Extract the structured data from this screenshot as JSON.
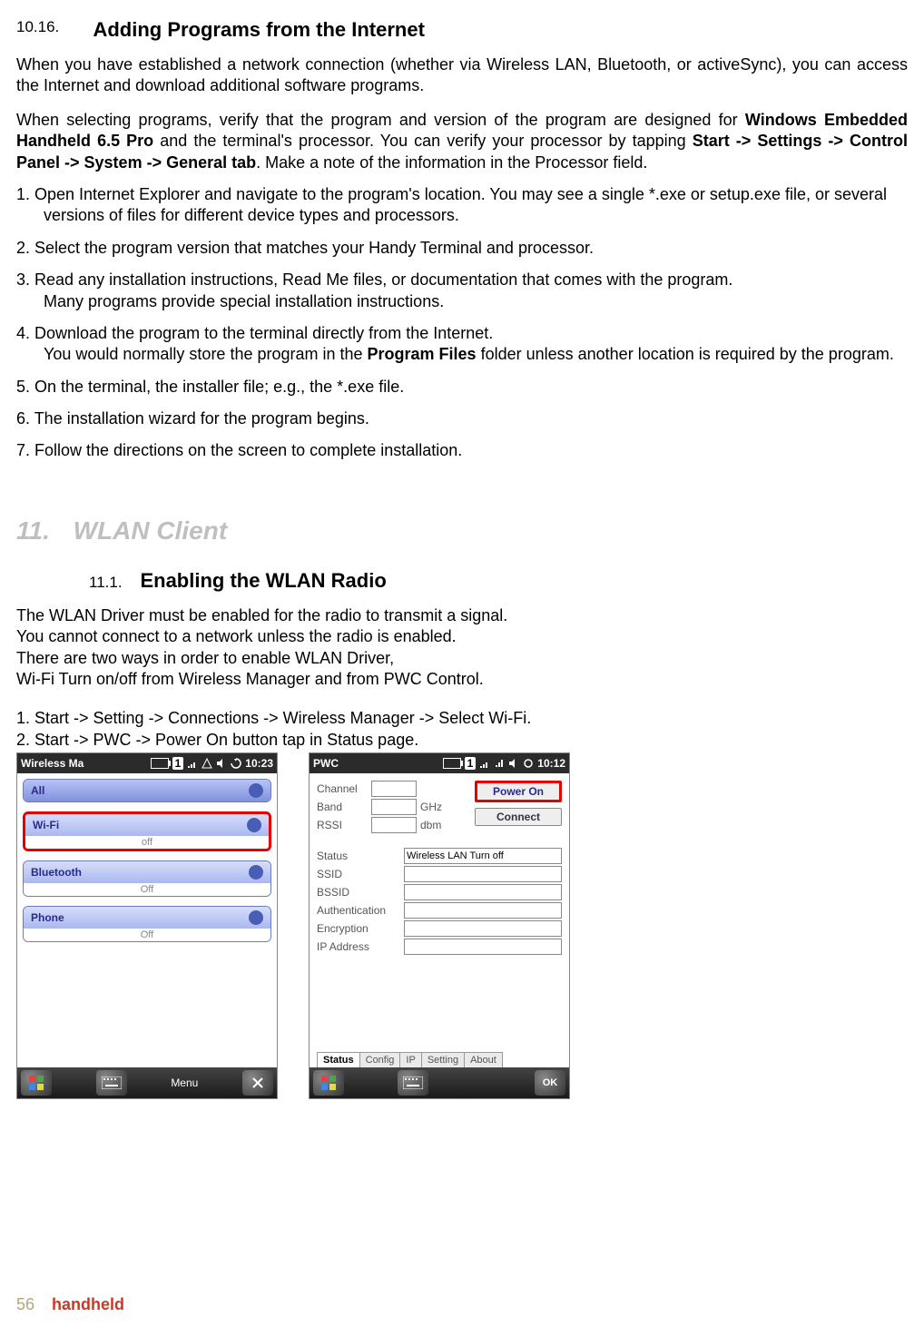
{
  "section1": {
    "num": "10.16.",
    "title": "Adding Programs from the Internet"
  },
  "para1_a": "When you have established a network connection (whether via Wireless LAN, Bluetooth, or activeSync), you can access the Internet and download additional software programs.",
  "para2_a": "When selecting programs, verify that the program and version of the program are designed for ",
  "para2_b": "Windows Embedded Handheld 6.5 Pro",
  "para2_c": " and the terminal's processor. You can verify your processor by tapping ",
  "para2_d": "Start -> Settings -> Control Panel -> System -> General tab",
  "para2_e": ". Make a note of the information in the Processor field.",
  "list": {
    "i1a": "1. Open Internet Explorer and navigate to the program's location. You may see a single *.exe or setup.exe file, or several",
    "i1b": "versions of files for different device types and processors.",
    "i2": "2. Select the program version that matches your Handy Terminal and processor.",
    "i3a": "3. Read any installation instructions, Read Me files, or documentation that comes with the program.",
    "i3b": "Many programs provide special installation instructions.",
    "i4a": "4. Download the program to the terminal directly from the Internet.",
    "i4b_a": "You would normally store the program in the ",
    "i4b_b": "Program Files",
    "i4b_c": " folder unless another location is required by the program.",
    "i5": "5. On the terminal, the installer file; e.g., the *.exe file.",
    "i6": "6. The installation wizard for the program begins.",
    "i7": "7. Follow the directions on the screen to complete installation."
  },
  "chapter": {
    "num": "11.",
    "title": "WLAN Client"
  },
  "subsec": {
    "num": "11.1.",
    "title": "Enabling the WLAN Radio"
  },
  "wlan_text": {
    "l1": "The WLAN Driver must be enabled for the radio to transmit a signal.",
    "l2": "You cannot connect to a network unless the radio is enabled.",
    "l3": "There are two ways in order to enable WLAN Driver,",
    "l4": "Wi-Fi Turn on/off from Wireless Manager and from PWC Control.",
    "s1": "1. Start -> Setting -> Connections -> Wireless Manager -> Select Wi-Fi.",
    "s2": "2. Start -> PWC -> Power On button tap in Status page."
  },
  "wm": {
    "app": "Wireless Ma",
    "sig": "1",
    "clock": "10:23",
    "all": "All",
    "wifi": "Wi-Fi",
    "wifi_off": "off",
    "bt": "Bluetooth",
    "bt_off": "Off",
    "phone": "Phone",
    "phone_off": "Off",
    "menu": "Menu"
  },
  "pwc": {
    "app": "PWC",
    "sig": "1",
    "clock": "10:12",
    "channel": "Channel",
    "band": "Band",
    "band_unit": "GHz",
    "rssi": "RSSI",
    "rssi_unit": "dbm",
    "poweron": "Power On",
    "connect": "Connect",
    "status": "Status",
    "status_val": "Wireless LAN Turn off",
    "ssid": "SSID",
    "bssid": "BSSID",
    "auth": "Authentication",
    "enc": "Encryption",
    "ip": "IP Address",
    "tabs": [
      "Status",
      "Config",
      "IP",
      "Setting",
      "About"
    ],
    "ok": "OK"
  },
  "footer": {
    "page": "56",
    "brand": "handheld"
  }
}
